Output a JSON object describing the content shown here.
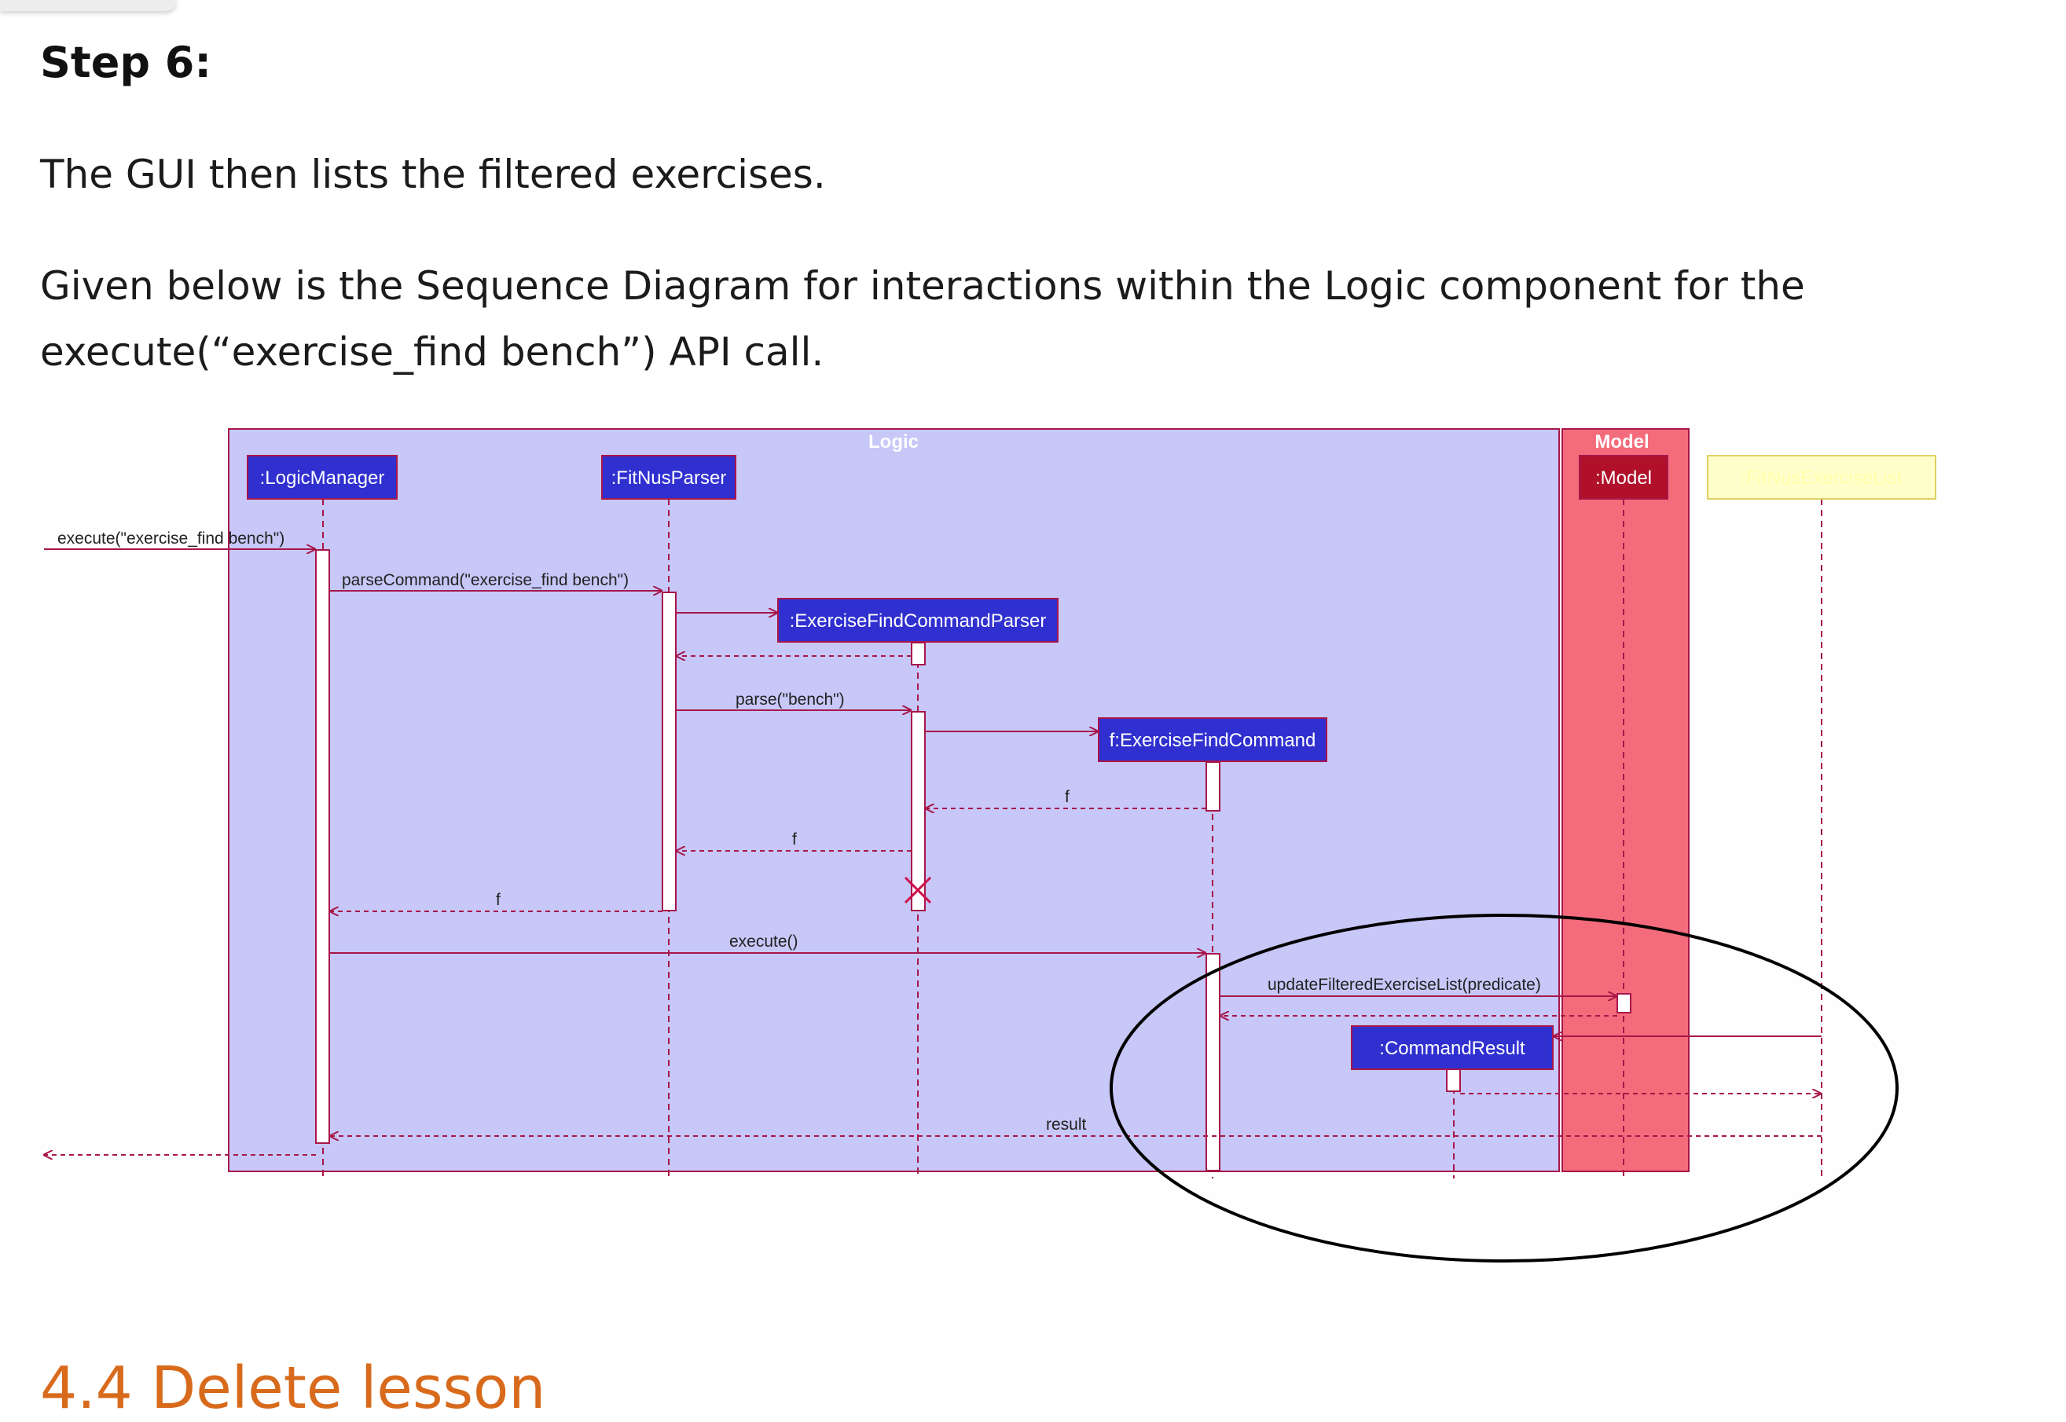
{
  "step": {
    "title": "Step 6:"
  },
  "paragraphs": {
    "p1": "The GUI then lists the filtered exercises.",
    "p2": "Given below is the Sequence Diagram for interactions within the Logic component for the execute(“exercise_find bench”) API call."
  },
  "diagram": {
    "frames": {
      "logic": "Logic",
      "model": "Model"
    },
    "participants": {
      "logic_manager": ":LogicManager",
      "parser": ":FitNusParser",
      "find_parser": ":ExerciseFindCommandParser",
      "find_command": "f:ExerciseFindCommand",
      "model": ":Model",
      "storage": ":FitNusExerciseList",
      "command_result": ":CommandResult"
    },
    "messages": {
      "execute_call": "execute(\"exercise_find bench\")",
      "parse_command": "parseCommand(\"exercise_find bench\")",
      "parse": "parse(\"bench\")",
      "return_f1": "f",
      "return_f2": "f",
      "return_f3": "f",
      "execute": "execute()",
      "update_list": "updateFilteredExerciseList(predicate)",
      "result": "result"
    },
    "colors": {
      "logic_frame": "#c7c7f8",
      "model_frame": "#f46c7c",
      "participant_box": "#3030d0",
      "model_box": "#b0102a",
      "lines": "#a8164a",
      "storage_box": "#ffffcc"
    }
  },
  "section": {
    "heading": "4.4 Delete lesson"
  }
}
